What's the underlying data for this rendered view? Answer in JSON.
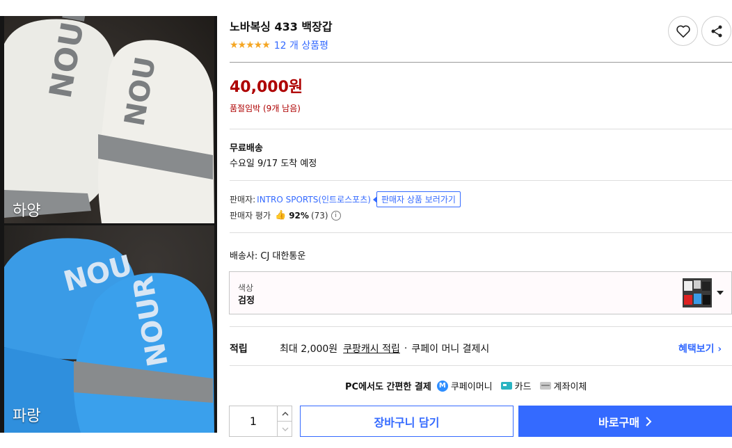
{
  "gallery": {
    "top_label": "하양",
    "bottom_label": "파랑"
  },
  "product": {
    "title": "노바복싱 433 백장갑",
    "stars": "★★★★★",
    "review_count": "12 개 상품평",
    "price": "40,000원",
    "stock_status": "품절임박",
    "stock_remaining": "(9개 남음)"
  },
  "shipping": {
    "title": "무료배송",
    "arrival": "수요일 9/17 도착 예정",
    "carrier": "배송사:  CJ 대한통운"
  },
  "seller": {
    "label": "판매자:",
    "name": "INTRO SPORTS(인트로스포츠)",
    "link_label": "판매자 상품 보러가기",
    "rating_label": "판매자 평가",
    "rating_pct": "92%",
    "rating_count": "(73)"
  },
  "option": {
    "label": "색상",
    "value": "검정"
  },
  "cash": {
    "label": "적립",
    "max": "최대 2,000원",
    "link": "쿠팡캐시 적립",
    "suffix": "쿠페이 머니 결제시",
    "benefit_link": "혜택보기 ›"
  },
  "payment": {
    "heading": "PC에서도 간편한 결제",
    "method1": "쿠페이머니",
    "method2": "카드",
    "method3": "계좌이체",
    "m_badge": "M"
  },
  "purchase": {
    "quantity": "1",
    "cart_label": "장바구니 담기",
    "buy_label": "바로구매"
  },
  "colors": {
    "accent": "#346aff",
    "price_red": "#ae0000",
    "star": "#f5a623"
  }
}
